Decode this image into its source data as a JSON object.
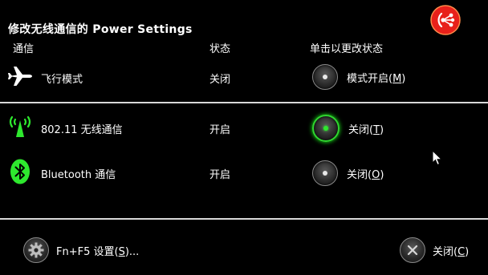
{
  "window": {
    "title": "修改无线通信的 Power Settings"
  },
  "columns": {
    "device": "通信",
    "status": "状态",
    "action": "单击以更改状态"
  },
  "rows": [
    {
      "icon": "airplane-icon",
      "label": "飞行模式",
      "status": "关闭",
      "toggle_text": "模式开启(",
      "toggle_key": "M",
      "toggle_close": ")",
      "toggle_on": false
    },
    {
      "icon": "wifi-antenna-icon",
      "label": "802.11 无线通信",
      "status": "开启",
      "toggle_text": "关闭(",
      "toggle_key": "T",
      "toggle_close": ")",
      "toggle_on": true
    },
    {
      "icon": "bluetooth-icon",
      "label": "Bluetooth 通信",
      "status": "开启",
      "toggle_text": "关闭(",
      "toggle_key": "O",
      "toggle_close": ")",
      "toggle_on": false
    }
  ],
  "footer": {
    "settings_text": "Fn+F5 设置(",
    "settings_key": "S",
    "settings_close": ")...",
    "close_text": "关闭(",
    "close_key": "C",
    "close_close": ")"
  },
  "colors": {
    "background": "#000000",
    "accent_green": "#2ee82e",
    "app_icon_red": "#e8201a"
  }
}
